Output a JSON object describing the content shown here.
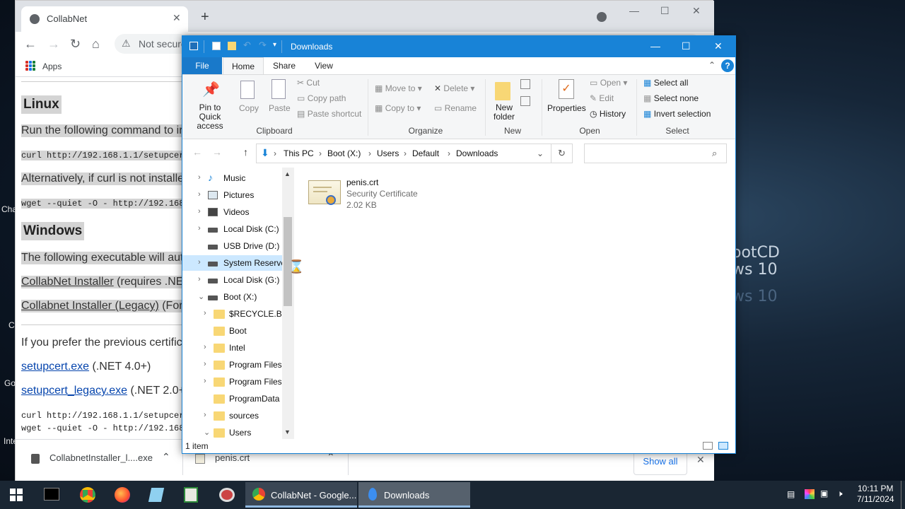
{
  "desktop": {
    "bg_lines": [
      "ootCD",
      "ws 10",
      "ws 10"
    ],
    "left_labels": [
      "Cha",
      "C",
      "Go",
      "Inte"
    ]
  },
  "chrome": {
    "tab_title": "CollabNet",
    "new_tab": "+",
    "address": "Not secure",
    "bookmark_apps": "Apps",
    "page": {
      "h_linux": "Linux",
      "linux_text": "Run the following command to ir",
      "curl_cmd": "curl http://192.168.1.1/setupcer",
      "alt_text": "Alternatively, if curl is not installe",
      "wget_cmd": "wget --quiet -O - http://192.168",
      "h_windows": "Windows",
      "win_text": "The following executable will aut",
      "link_installer": "CollabNet Installer",
      "link_installer_suffix": " (requires .NE",
      "link_legacy": "Collabnet Installer (Legacy)",
      "link_legacy_suffix": " (For",
      "prefer_text": "If you prefer the previous certific",
      "link_setupcert": "setupcert.exe",
      "setupcert_suffix": " (.NET 4.0+)",
      "link_setupcert_legacy": "setupcert_legacy.exe",
      "setupcert_legacy_suffix": " (.NET 2.0+",
      "curl_cmd2": "curl http://192.168.1.1/setupcer",
      "wget_cmd2": "wget --quiet -O - http://192.168"
    },
    "downloads": {
      "item1": "CollabnetInstaller_l....exe",
      "item2": "penis.crt",
      "show_all": "Show all"
    }
  },
  "explorer": {
    "title": "Downloads",
    "tabs": [
      "File",
      "Home",
      "Share",
      "View"
    ],
    "ribbon": {
      "pin": "Pin to Quick access",
      "copy": "Copy",
      "paste": "Paste",
      "cut": "Cut",
      "copy_path": "Copy path",
      "paste_shortcut": "Paste shortcut",
      "move_to": "Move to",
      "copy_to": "Copy to",
      "delete": "Delete",
      "rename": "Rename",
      "new_folder": "New folder",
      "properties": "Properties",
      "open": "Open",
      "edit": "Edit",
      "history": "History",
      "select_all": "Select all",
      "select_none": "Select none",
      "invert_selection": "Invert selection",
      "groups": [
        "Clipboard",
        "Organize",
        "New",
        "Open",
        "Select"
      ]
    },
    "breadcrumb": [
      "This PC",
      "Boot (X:)",
      "Users",
      "Default",
      "Downloads"
    ],
    "search_placeholder": "",
    "tree": [
      {
        "label": "Music",
        "type": "music"
      },
      {
        "label": "Pictures",
        "type": "pictures"
      },
      {
        "label": "Videos",
        "type": "videos"
      },
      {
        "label": "Local Disk (C:)",
        "type": "drive"
      },
      {
        "label": "USB Drive (D:)",
        "type": "drive"
      },
      {
        "label": "System Reserve",
        "type": "drive"
      },
      {
        "label": "Local Disk (G:)",
        "type": "drive"
      },
      {
        "label": "Boot (X:)",
        "type": "drive"
      },
      {
        "label": "$RECYCLE.BIN",
        "type": "folder"
      },
      {
        "label": "Boot",
        "type": "folder"
      },
      {
        "label": "Intel",
        "type": "folder"
      },
      {
        "label": "Program Files",
        "type": "folder"
      },
      {
        "label": "Program Files",
        "type": "folder"
      },
      {
        "label": "ProgramData",
        "type": "folder"
      },
      {
        "label": "sources",
        "type": "folder"
      },
      {
        "label": "Users",
        "type": "folder"
      }
    ],
    "file": {
      "name": "penis.crt",
      "type": "Security Certificate",
      "size": "2.02 KB"
    },
    "status": "1 item",
    "accent": "#1883d7"
  },
  "taskbar": {
    "app1": "CollabNet - Google...",
    "app2": "Downloads",
    "time": "10:11 PM",
    "date": "7/11/2024"
  }
}
